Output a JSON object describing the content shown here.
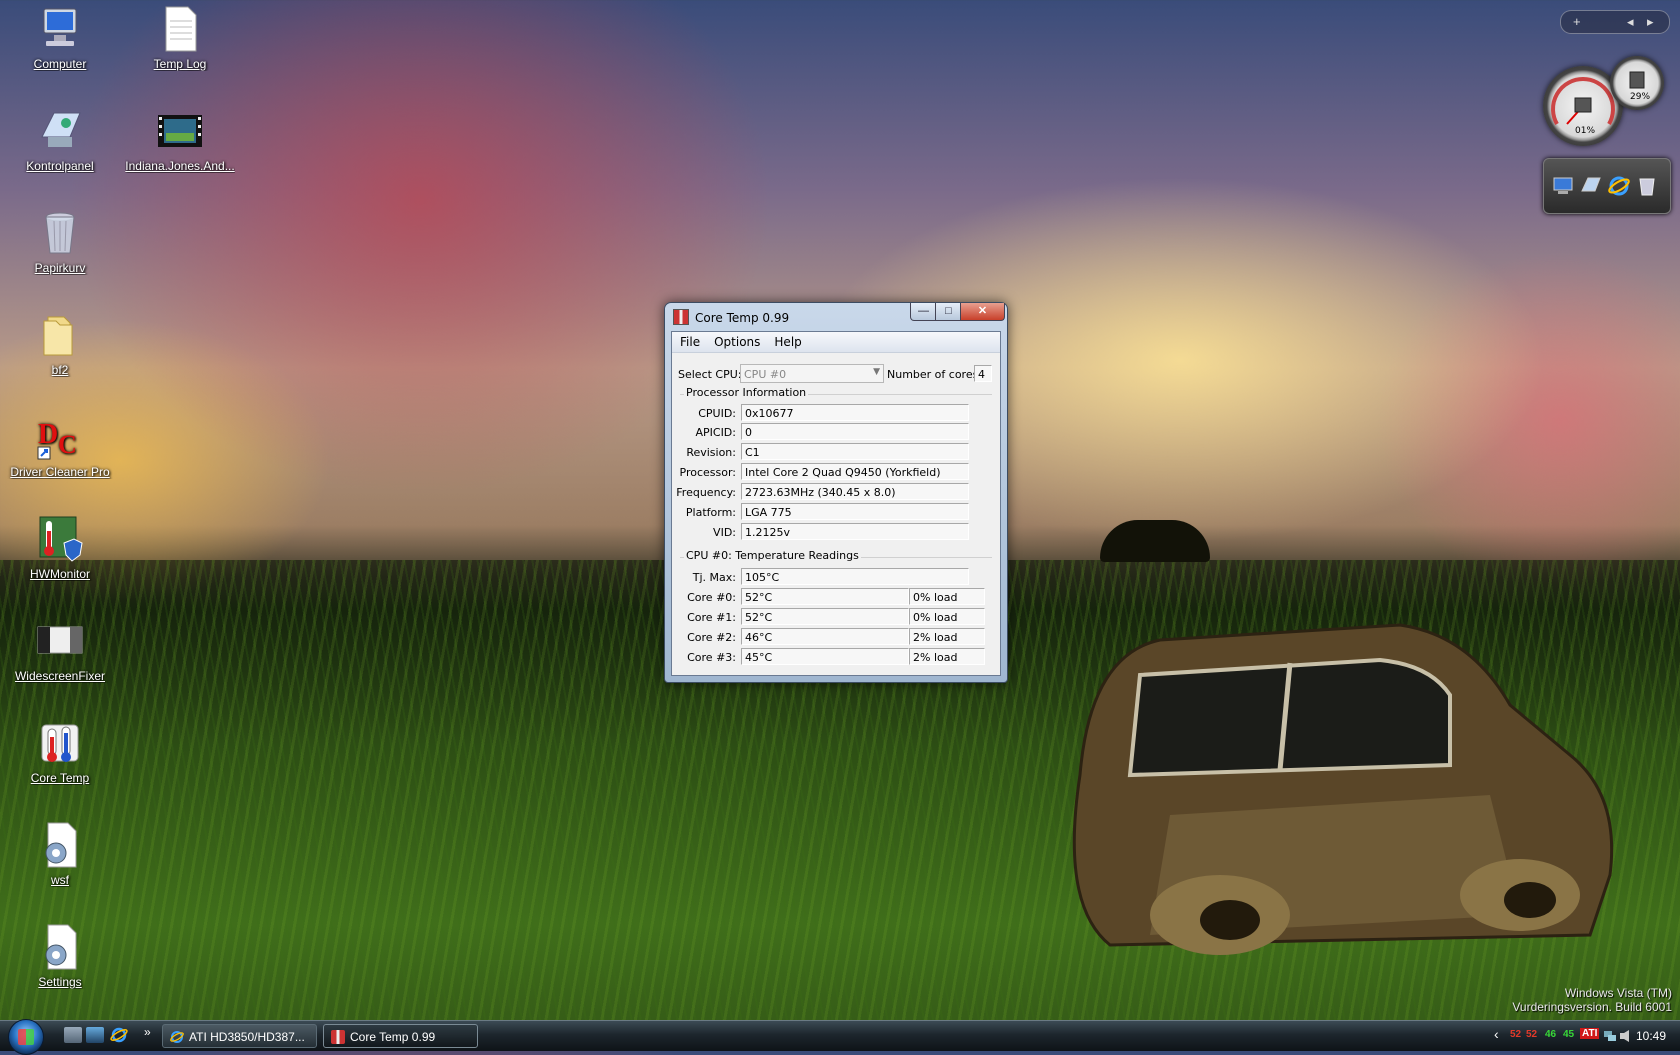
{
  "desktop": {
    "icons": [
      {
        "label": "Computer"
      },
      {
        "label": "Temp Log"
      },
      {
        "label": "Kontrolpanel"
      },
      {
        "label": "Indiana.Jones.And..."
      },
      {
        "label": "Papirkurv"
      },
      {
        "label": "bf2"
      },
      {
        "label": "Driver Cleaner Pro"
      },
      {
        "label": "HWMonitor"
      },
      {
        "label": "WidescreenFixer"
      },
      {
        "label": "Core Temp"
      },
      {
        "label": "wsf"
      },
      {
        "label": "Settings"
      }
    ],
    "watermark": {
      "line1": "Windows Vista (TM)",
      "line2": "Vurderingsversion. Build 6001"
    }
  },
  "gadgets": {
    "sidebar_add": "+",
    "sidebar_prev": "◂",
    "sidebar_next": "▸",
    "cpu_gauge": {
      "cpu_percent": "01%",
      "mem_percent": "29%"
    }
  },
  "window": {
    "title": "Core Temp 0.99",
    "min_glyph": "—",
    "max_glyph": "□",
    "close_glyph": "✕",
    "menu": [
      "File",
      "Options",
      "Help"
    ],
    "select_cpu_label": "Select CPU:",
    "select_cpu_value": "CPU #0",
    "num_cores_label": "Number of cores",
    "num_cores_value": "4",
    "proc_group_title": "Processor Information",
    "proc_fields": [
      {
        "label": "CPUID:",
        "value": "0x10677"
      },
      {
        "label": "APICID:",
        "value": "0"
      },
      {
        "label": "Revision:",
        "value": "C1"
      },
      {
        "label": "Processor:",
        "value": "Intel Core 2 Quad Q9450 (Yorkfield)"
      },
      {
        "label": "Frequency:",
        "value": "2723.63MHz (340.45 x 8.0)"
      },
      {
        "label": "Platform:",
        "value": "LGA 775"
      },
      {
        "label": "VID:",
        "value": "1.2125v"
      }
    ],
    "temp_group_title": "CPU #0: Temperature Readings",
    "tjmax_label": "Tj. Max:",
    "tjmax_value": "105°C",
    "cores": [
      {
        "label": "Core #0:",
        "temp": "52°C",
        "load": "0% load"
      },
      {
        "label": "Core #1:",
        "temp": "52°C",
        "load": "0% load"
      },
      {
        "label": "Core #2:",
        "temp": "46°C",
        "load": "2% load"
      },
      {
        "label": "Core #3:",
        "temp": "45°C",
        "load": "2% load"
      }
    ]
  },
  "taskbar": {
    "tasks": [
      {
        "label": "ATI HD3850/HD387..."
      },
      {
        "label": "Core Temp 0.99"
      }
    ],
    "quicklaunch_more": "»",
    "tray_arrow": "‹",
    "tray_temps": [
      "52",
      "52",
      "46",
      "45"
    ],
    "tray_ati": "ATI",
    "clock": "10:49",
    "colors": {
      "temp_red": "#e23a2a",
      "temp_green": "#38d838"
    }
  }
}
